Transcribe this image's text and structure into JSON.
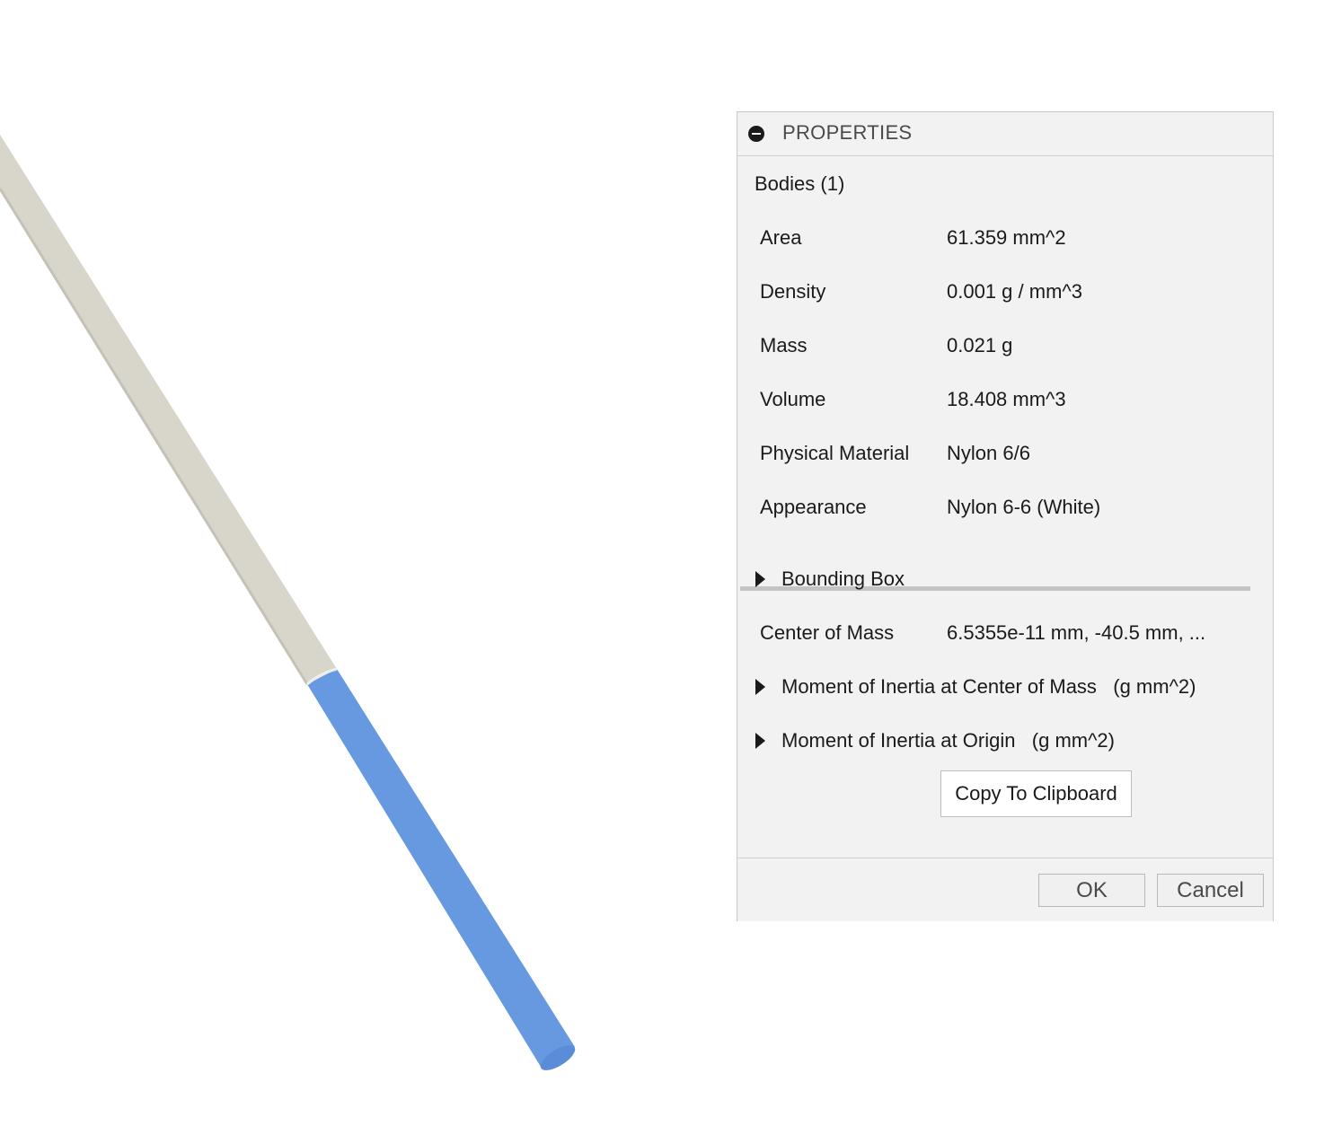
{
  "viewport": {
    "model_colors": {
      "body": "#d8d6cb",
      "selected": "#6699e0"
    }
  },
  "panel": {
    "header_title": "PROPERTIES",
    "collapse_icon": "collapse-icon",
    "section_title": "Bodies (1)",
    "rows": [
      {
        "label": "Area",
        "value": "61.359 mm^2"
      },
      {
        "label": "Density",
        "value": "0.001 g / mm^3"
      },
      {
        "label": "Mass",
        "value": "0.021 g"
      },
      {
        "label": "Volume",
        "value": "18.408 mm^3"
      },
      {
        "label": "Physical Material",
        "value": "Nylon 6/6"
      },
      {
        "label": "Appearance",
        "value": "Nylon 6-6 (White)"
      }
    ],
    "bounding_box_label": "Bounding Box",
    "center_of_mass": {
      "label": "Center of Mass",
      "value": "6.5355e-11 mm, -40.5 mm, ..."
    },
    "moment_center_label": "Moment of Inertia at Center of Mass   (g mm^2)",
    "moment_origin_label": "Moment of Inertia at Origin   (g mm^2)",
    "copy_button_label": "Copy To Clipboard",
    "ok_label": "OK",
    "cancel_label": "Cancel"
  }
}
